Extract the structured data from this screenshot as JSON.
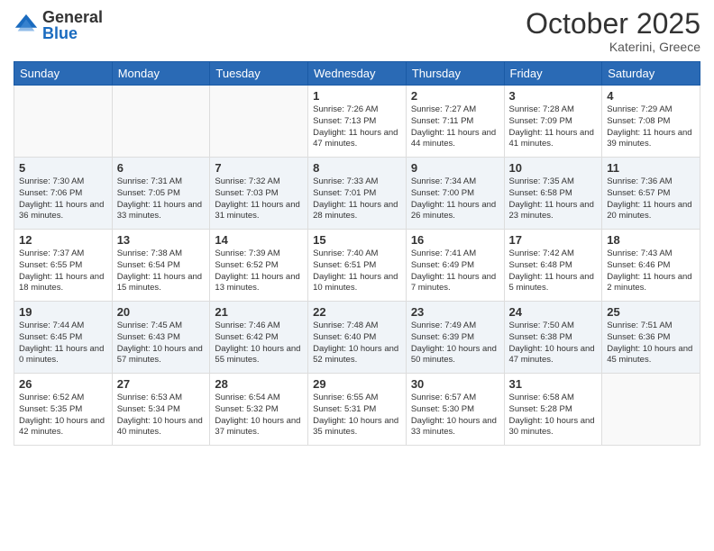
{
  "header": {
    "logo_general": "General",
    "logo_blue": "Blue",
    "month": "October 2025",
    "location": "Katerini, Greece"
  },
  "days_of_week": [
    "Sunday",
    "Monday",
    "Tuesday",
    "Wednesday",
    "Thursday",
    "Friday",
    "Saturday"
  ],
  "weeks": [
    [
      {
        "num": "",
        "info": ""
      },
      {
        "num": "",
        "info": ""
      },
      {
        "num": "",
        "info": ""
      },
      {
        "num": "1",
        "info": "Sunrise: 7:26 AM\nSunset: 7:13 PM\nDaylight: 11 hours\nand 47 minutes."
      },
      {
        "num": "2",
        "info": "Sunrise: 7:27 AM\nSunset: 7:11 PM\nDaylight: 11 hours\nand 44 minutes."
      },
      {
        "num": "3",
        "info": "Sunrise: 7:28 AM\nSunset: 7:09 PM\nDaylight: 11 hours\nand 41 minutes."
      },
      {
        "num": "4",
        "info": "Sunrise: 7:29 AM\nSunset: 7:08 PM\nDaylight: 11 hours\nand 39 minutes."
      }
    ],
    [
      {
        "num": "5",
        "info": "Sunrise: 7:30 AM\nSunset: 7:06 PM\nDaylight: 11 hours\nand 36 minutes."
      },
      {
        "num": "6",
        "info": "Sunrise: 7:31 AM\nSunset: 7:05 PM\nDaylight: 11 hours\nand 33 minutes."
      },
      {
        "num": "7",
        "info": "Sunrise: 7:32 AM\nSunset: 7:03 PM\nDaylight: 11 hours\nand 31 minutes."
      },
      {
        "num": "8",
        "info": "Sunrise: 7:33 AM\nSunset: 7:01 PM\nDaylight: 11 hours\nand 28 minutes."
      },
      {
        "num": "9",
        "info": "Sunrise: 7:34 AM\nSunset: 7:00 PM\nDaylight: 11 hours\nand 26 minutes."
      },
      {
        "num": "10",
        "info": "Sunrise: 7:35 AM\nSunset: 6:58 PM\nDaylight: 11 hours\nand 23 minutes."
      },
      {
        "num": "11",
        "info": "Sunrise: 7:36 AM\nSunset: 6:57 PM\nDaylight: 11 hours\nand 20 minutes."
      }
    ],
    [
      {
        "num": "12",
        "info": "Sunrise: 7:37 AM\nSunset: 6:55 PM\nDaylight: 11 hours\nand 18 minutes."
      },
      {
        "num": "13",
        "info": "Sunrise: 7:38 AM\nSunset: 6:54 PM\nDaylight: 11 hours\nand 15 minutes."
      },
      {
        "num": "14",
        "info": "Sunrise: 7:39 AM\nSunset: 6:52 PM\nDaylight: 11 hours\nand 13 minutes."
      },
      {
        "num": "15",
        "info": "Sunrise: 7:40 AM\nSunset: 6:51 PM\nDaylight: 11 hours\nand 10 minutes."
      },
      {
        "num": "16",
        "info": "Sunrise: 7:41 AM\nSunset: 6:49 PM\nDaylight: 11 hours\nand 7 minutes."
      },
      {
        "num": "17",
        "info": "Sunrise: 7:42 AM\nSunset: 6:48 PM\nDaylight: 11 hours\nand 5 minutes."
      },
      {
        "num": "18",
        "info": "Sunrise: 7:43 AM\nSunset: 6:46 PM\nDaylight: 11 hours\nand 2 minutes."
      }
    ],
    [
      {
        "num": "19",
        "info": "Sunrise: 7:44 AM\nSunset: 6:45 PM\nDaylight: 11 hours\nand 0 minutes."
      },
      {
        "num": "20",
        "info": "Sunrise: 7:45 AM\nSunset: 6:43 PM\nDaylight: 10 hours\nand 57 minutes."
      },
      {
        "num": "21",
        "info": "Sunrise: 7:46 AM\nSunset: 6:42 PM\nDaylight: 10 hours\nand 55 minutes."
      },
      {
        "num": "22",
        "info": "Sunrise: 7:48 AM\nSunset: 6:40 PM\nDaylight: 10 hours\nand 52 minutes."
      },
      {
        "num": "23",
        "info": "Sunrise: 7:49 AM\nSunset: 6:39 PM\nDaylight: 10 hours\nand 50 minutes."
      },
      {
        "num": "24",
        "info": "Sunrise: 7:50 AM\nSunset: 6:38 PM\nDaylight: 10 hours\nand 47 minutes."
      },
      {
        "num": "25",
        "info": "Sunrise: 7:51 AM\nSunset: 6:36 PM\nDaylight: 10 hours\nand 45 minutes."
      }
    ],
    [
      {
        "num": "26",
        "info": "Sunrise: 6:52 AM\nSunset: 5:35 PM\nDaylight: 10 hours\nand 42 minutes."
      },
      {
        "num": "27",
        "info": "Sunrise: 6:53 AM\nSunset: 5:34 PM\nDaylight: 10 hours\nand 40 minutes."
      },
      {
        "num": "28",
        "info": "Sunrise: 6:54 AM\nSunset: 5:32 PM\nDaylight: 10 hours\nand 37 minutes."
      },
      {
        "num": "29",
        "info": "Sunrise: 6:55 AM\nSunset: 5:31 PM\nDaylight: 10 hours\nand 35 minutes."
      },
      {
        "num": "30",
        "info": "Sunrise: 6:57 AM\nSunset: 5:30 PM\nDaylight: 10 hours\nand 33 minutes."
      },
      {
        "num": "31",
        "info": "Sunrise: 6:58 AM\nSunset: 5:28 PM\nDaylight: 10 hours\nand 30 minutes."
      },
      {
        "num": "",
        "info": ""
      }
    ]
  ]
}
